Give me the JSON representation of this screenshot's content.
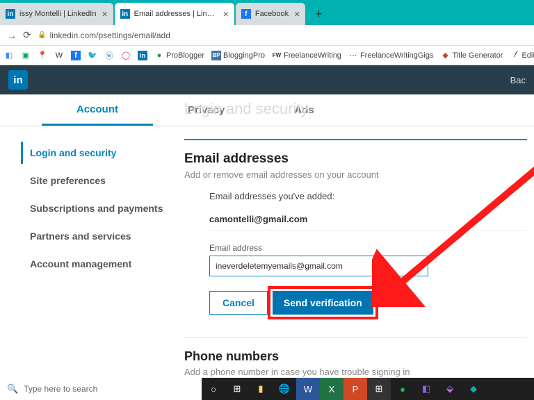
{
  "browser": {
    "tabs": [
      {
        "label": "issy Montelli | LinkedIn",
        "favicon_bg": "#0077b5",
        "favicon_text": "in"
      },
      {
        "label": "Email addresses | LinkedIn",
        "favicon_bg": "#0077b5",
        "favicon_text": "in"
      },
      {
        "label": "Facebook",
        "favicon_bg": "#1877f2",
        "favicon_text": "f"
      }
    ],
    "url": "linkedin.com/psettings/email/add"
  },
  "bookmarks": [
    {
      "label": "",
      "color": "#4285f4",
      "icon": "◧"
    },
    {
      "label": "",
      "color": "#0f9d58",
      "icon": "▣"
    },
    {
      "label": "",
      "color": "#ea4335",
      "icon": "📍"
    },
    {
      "label": "W",
      "color": "#555",
      "icon": "W"
    },
    {
      "label": "",
      "color": "#1877f2",
      "icon": "f"
    },
    {
      "label": "",
      "color": "#1da1f2",
      "icon": "🐦"
    },
    {
      "label": "",
      "color": "#21759b",
      "icon": "ⓦ"
    },
    {
      "label": "",
      "color": "#e1306c",
      "icon": "◯"
    },
    {
      "label": "",
      "color": "#0077b5",
      "icon": "in"
    },
    {
      "label": "ProBlogger",
      "color": "#2e8b3d",
      "icon": "●"
    },
    {
      "label": "BloggingPro",
      "color": "#4573a8",
      "icon": "BP"
    },
    {
      "label": "FreelanceWriting",
      "color": "#333",
      "icon": "FW"
    },
    {
      "label": "FreelanceWritingGigs",
      "color": "#555",
      "icon": "⋯"
    },
    {
      "label": "Title Generator",
      "color": "#c14b2a",
      "icon": "◆"
    },
    {
      "label": "Editorial",
      "color": "#333",
      "icon": "𝑓"
    }
  ],
  "nav": {
    "logo": "in",
    "back": "Bac"
  },
  "tabs": {
    "account": "Account",
    "privacy": "Privacy",
    "ads": "Ads"
  },
  "ghost": "Login and security",
  "sidebar": [
    "Login and security",
    "Site preferences",
    "Subscriptions and payments",
    "Partners and services",
    "Account management"
  ],
  "emails": {
    "title": "Email addresses",
    "sub": "Add or remove email addresses on your account",
    "added_label": "Email addresses you've added:",
    "added_value": "camontelli@gmail.com",
    "field_label": "Email address",
    "input_value": "ineverdeletemyemails@gmail.com",
    "cancel": "Cancel",
    "send": "Send verification"
  },
  "phone": {
    "title": "Phone numbers",
    "sub": "Add a phone number in case you have trouble signing in"
  },
  "taskbar": {
    "search": "Type here to search"
  }
}
